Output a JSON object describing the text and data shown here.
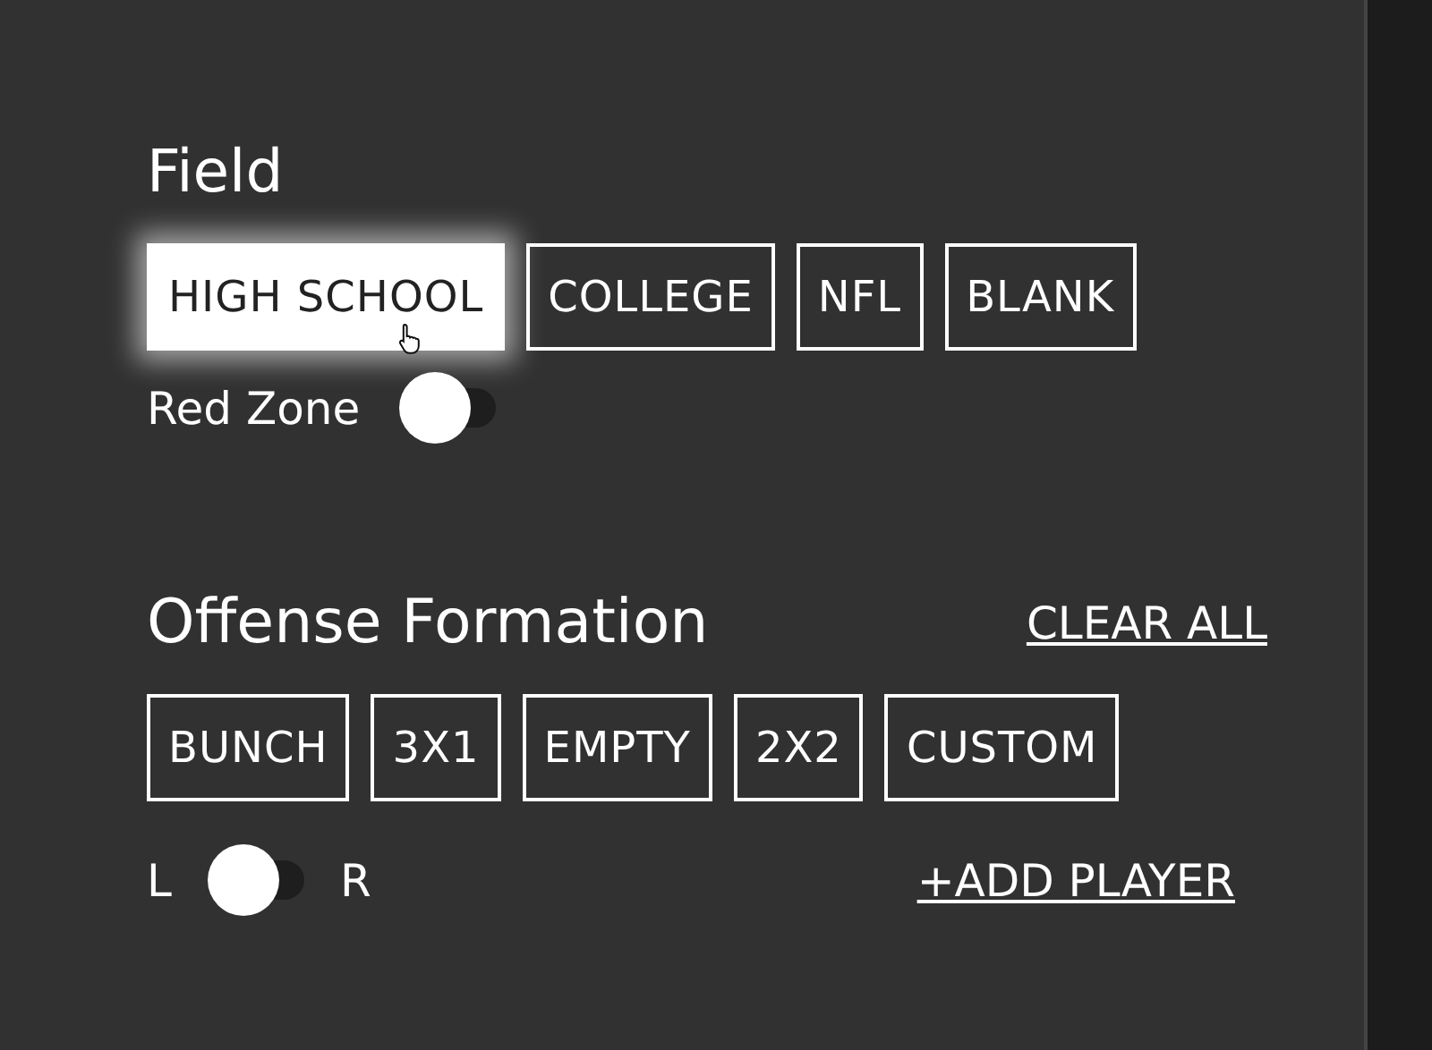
{
  "field": {
    "title": "Field",
    "options": [
      {
        "label": "HIGH SCHOOL",
        "selected": true
      },
      {
        "label": "COLLEGE",
        "selected": false
      },
      {
        "label": "NFL",
        "selected": false
      },
      {
        "label": "BLANK",
        "selected": false
      }
    ],
    "red_zone": {
      "label": "Red Zone",
      "on": false
    }
  },
  "offense": {
    "title": "Offense Formation",
    "clear_all": "CLEAR ALL",
    "formations": [
      {
        "label": "BUNCH",
        "selected": false
      },
      {
        "label": "3X1",
        "selected": false
      },
      {
        "label": "EMPTY",
        "selected": false
      },
      {
        "label": "2X2",
        "selected": false
      },
      {
        "label": "CUSTOM",
        "selected": false
      }
    ],
    "side": {
      "left_label": "L",
      "right_label": "R",
      "on": false
    },
    "add_player": "+ADD PLAYER"
  }
}
